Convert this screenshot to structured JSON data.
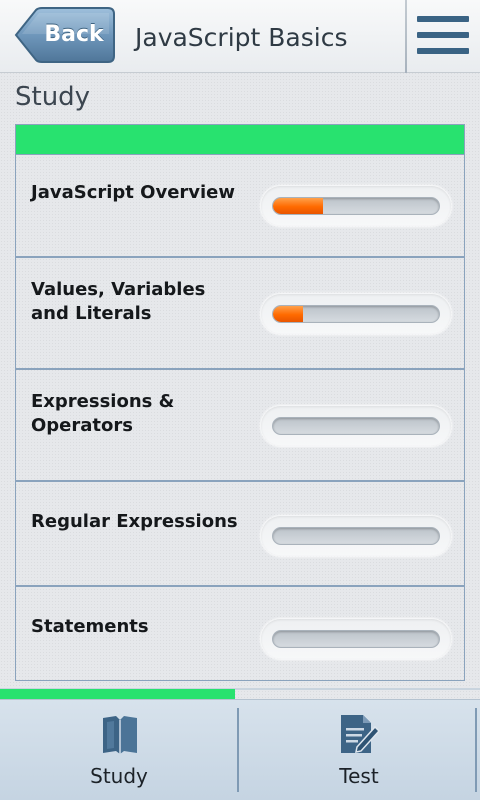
{
  "header": {
    "back_label": "Back",
    "title": "JavaScript Basics",
    "menu_icon": "hamburger-menu-icon"
  },
  "section": {
    "title": "Study"
  },
  "lessons": [
    {
      "title": "JavaScript Overview",
      "progress": 0.3
    },
    {
      "title": "Values, Variables and Literals",
      "progress": 0.18
    },
    {
      "title": "Expressions & Operators",
      "progress": 0
    },
    {
      "title": "Regular Expressions",
      "progress": 0
    },
    {
      "title": "Statements",
      "progress": 0
    }
  ],
  "overall_progress": 0.49,
  "tabs": [
    {
      "label": "Study",
      "icon": "book-icon"
    },
    {
      "label": "Test",
      "icon": "test-pencil-icon"
    }
  ],
  "colors": {
    "accent_green": "#28e26f",
    "progress_orange": "#ff6a00",
    "nav_blue": "#3a6384"
  }
}
